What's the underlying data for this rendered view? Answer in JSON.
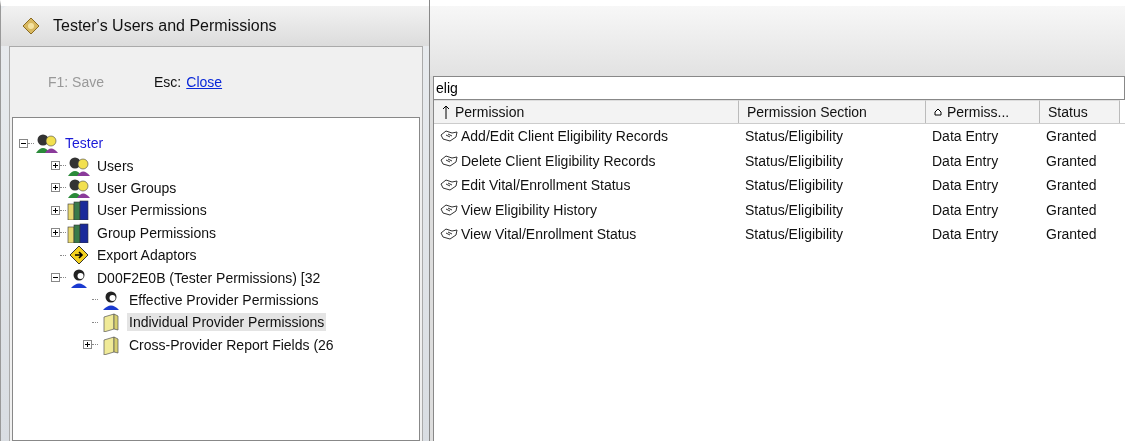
{
  "left_window": {
    "title": "Tester's Users and Permissions",
    "toolbar": {
      "save": {
        "label": "F1: Save",
        "disabled": true
      },
      "close_key": "Esc:",
      "close_link": "Close"
    },
    "tree": [
      {
        "label": "Tester",
        "kind": "people",
        "expandable": true,
        "expanded": true,
        "selected": false,
        "root": true,
        "children": [
          {
            "label": "Users",
            "kind": "people",
            "expandable": true,
            "expanded": false,
            "selected": false
          },
          {
            "label": "User Groups",
            "kind": "people",
            "expandable": true,
            "expanded": false,
            "selected": false
          },
          {
            "label": "User Permissions",
            "kind": "books",
            "expandable": true,
            "expanded": false,
            "selected": false
          },
          {
            "label": "Group Permissions",
            "kind": "books",
            "expandable": true,
            "expanded": false,
            "selected": false
          },
          {
            "label": "Export Adaptors",
            "kind": "sign",
            "expandable": false,
            "selected": false
          },
          {
            "label": "D00F2E0B (Tester Permissions) [32",
            "kind": "person",
            "expandable": true,
            "expanded": true,
            "selected": false,
            "children": [
              {
                "label": "Effective Provider Permissions",
                "kind": "person",
                "expandable": false,
                "selected": false
              },
              {
                "label": "Individual Provider Permissions",
                "kind": "folder",
                "expandable": false,
                "selected": true
              },
              {
                "label": "Cross-Provider Report Fields (26",
                "kind": "folder",
                "expandable": true,
                "expanded": false,
                "selected": false
              }
            ]
          }
        ]
      }
    ]
  },
  "right_window": {
    "search": {
      "value": "elig"
    },
    "table": {
      "columns": [
        {
          "label": "Permission",
          "kind": "sorted"
        },
        {
          "label": "Permission Section",
          "kind": "plain"
        },
        {
          "label": "Permiss...",
          "kind": "grouped"
        },
        {
          "label": "Status",
          "kind": "plain"
        }
      ],
      "rows": [
        [
          "Add/Edit Client Eligibility Records",
          "Status/Eligibility",
          "Data Entry",
          "Granted"
        ],
        [
          "Delete Client Eligibility Records",
          "Status/Eligibility",
          "Data Entry",
          "Granted"
        ],
        [
          "Edit Vital/Enrollment Status",
          "Status/Eligibility",
          "Data Entry",
          "Granted"
        ],
        [
          "View Eligibility History",
          "Status/Eligibility",
          "Data Entry",
          "Granted"
        ],
        [
          "View Vital/Enrollment Status",
          "Status/Eligibility",
          "Data Entry",
          "Granted"
        ]
      ]
    }
  }
}
